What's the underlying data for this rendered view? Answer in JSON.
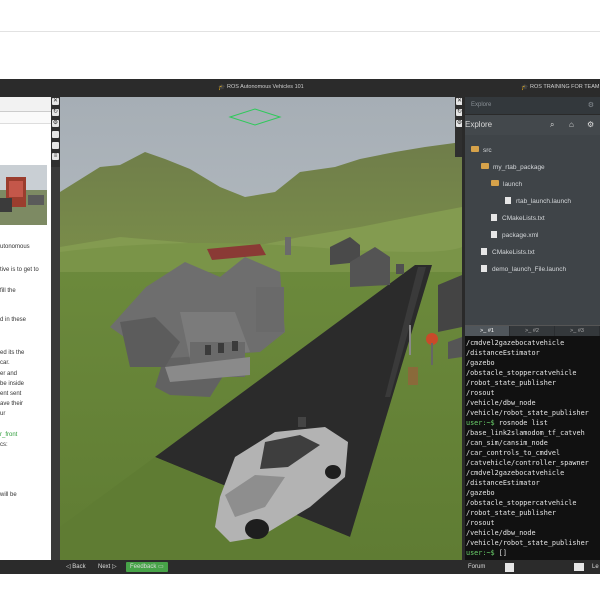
{
  "window": {
    "title_center": "ROS Autonomous Vehicles 101",
    "title_right": "ROS TRAINING FOR TEAM"
  },
  "left_panel": {
    "lines": [
      {
        "text": "utonomous",
        "color": "#333333"
      },
      {
        "text": "tive is to get to",
        "color": "#333333"
      },
      {
        "text": "fill the",
        "color": "#333333"
      },
      {
        "text": "d in these",
        "color": "#333333"
      },
      {
        "text": "ed its the",
        "color": "#333333"
      },
      {
        "text": "car.",
        "color": "#333333"
      },
      {
        "text": "er and",
        "color": "#333333"
      },
      {
        "text": "be inside",
        "color": "#333333"
      },
      {
        "text": "ent sent",
        "color": "#333333"
      },
      {
        "text": "ave their",
        "color": "#333333"
      },
      {
        "text": "ur",
        "color": "#333333"
      },
      {
        "text": "r_front",
        "color": "#2e9d3a"
      },
      {
        "text": "cs:",
        "color": "#333333"
      },
      {
        "text": "will be",
        "color": "#333333"
      }
    ]
  },
  "explorer": {
    "search_placeholder": "Explore",
    "title": "Explore",
    "tree": [
      {
        "type": "folder",
        "label": "src",
        "level": 0
      },
      {
        "type": "folder",
        "label": "my_rtab_package",
        "level": 1
      },
      {
        "type": "folder",
        "label": "launch",
        "level": 2
      },
      {
        "type": "file",
        "label": "rtab_launch.launch",
        "level": 3
      },
      {
        "type": "file",
        "label": "CMakeLists.txt",
        "level": 2
      },
      {
        "type": "file",
        "label": "package.xml",
        "level": 2
      },
      {
        "type": "file",
        "label": "CMakeLists.txt",
        "level": 1
      },
      {
        "type": "file",
        "label": "demo_launch_File.launch",
        "level": 1
      }
    ]
  },
  "terminal": {
    "tabs": [
      ">_ #1",
      ">_ #2",
      ">_ #3"
    ],
    "active_tab": 0,
    "lines": [
      {
        "text": "/cmdvel2gazebocatvehicle",
        "color": "#e6e6e6"
      },
      {
        "text": "/distanceEstimator",
        "color": "#e6e6e6"
      },
      {
        "text": "/gazebo",
        "color": "#e6e6e6"
      },
      {
        "text": "/obstacle_stoppercatvehicle",
        "color": "#e6e6e6"
      },
      {
        "text": "/robot_state_publisher",
        "color": "#e6e6e6"
      },
      {
        "text": "/rosout",
        "color": "#e6e6e6"
      },
      {
        "text": "/vehicle/dbw_node",
        "color": "#e6e6e6"
      },
      {
        "text": "/vehicle/robot_state_publisher",
        "color": "#e6e6e6"
      },
      {
        "text": "user:~$ rosnode list",
        "color": "#e6e6e6",
        "prompt": "user:~$"
      },
      {
        "text": "/base_link2slamodom_tf_catveh",
        "color": "#e6e6e6"
      },
      {
        "text": "/can_sim/cansim_node",
        "color": "#e6e6e6"
      },
      {
        "text": "/car_controls_to_cmdvel",
        "color": "#e6e6e6"
      },
      {
        "text": "/catvehicle/controller_spawner",
        "color": "#e6e6e6"
      },
      {
        "text": "/cmdvel2gazebocatvehicle",
        "color": "#e6e6e6"
      },
      {
        "text": "/distanceEstimator",
        "color": "#e6e6e6"
      },
      {
        "text": "/gazebo",
        "color": "#e6e6e6"
      },
      {
        "text": "/obstacle_stoppercatvehicle",
        "color": "#e6e6e6"
      },
      {
        "text": "/robot_state_publisher",
        "color": "#e6e6e6"
      },
      {
        "text": "/rosout",
        "color": "#e6e6e6"
      },
      {
        "text": "/vehicle/dbw_node",
        "color": "#e6e6e6"
      },
      {
        "text": "/vehicle/robot_state_publisher",
        "color": "#e6e6e6"
      },
      {
        "text": "user:~$ []",
        "color": "#e6e6e6",
        "prompt": "user:~$"
      }
    ]
  },
  "bottom_bar": {
    "back": "◁ Back",
    "next": "Next ▷",
    "feedback": "Feedback",
    "forum": "Forum",
    "truncated_right": "Le"
  },
  "colors": {
    "feedback_green": "#47a348",
    "folder": "#d6a24a",
    "prompt_green": "#6bd36b",
    "grass": "#6f8a3e",
    "road": "#2d2d2d"
  },
  "icons": {
    "left_strip": [
      "close-icon",
      "refresh-icon",
      "settings-icon",
      "square-icon",
      "panel-icon",
      "menu-icon"
    ],
    "explorer_header": [
      "search-icon",
      "home-icon",
      "settings-icon"
    ],
    "terminal_tabs": [
      "terminal-icon"
    ],
    "bottom": [
      "grid-icon",
      "mail-icon"
    ]
  }
}
